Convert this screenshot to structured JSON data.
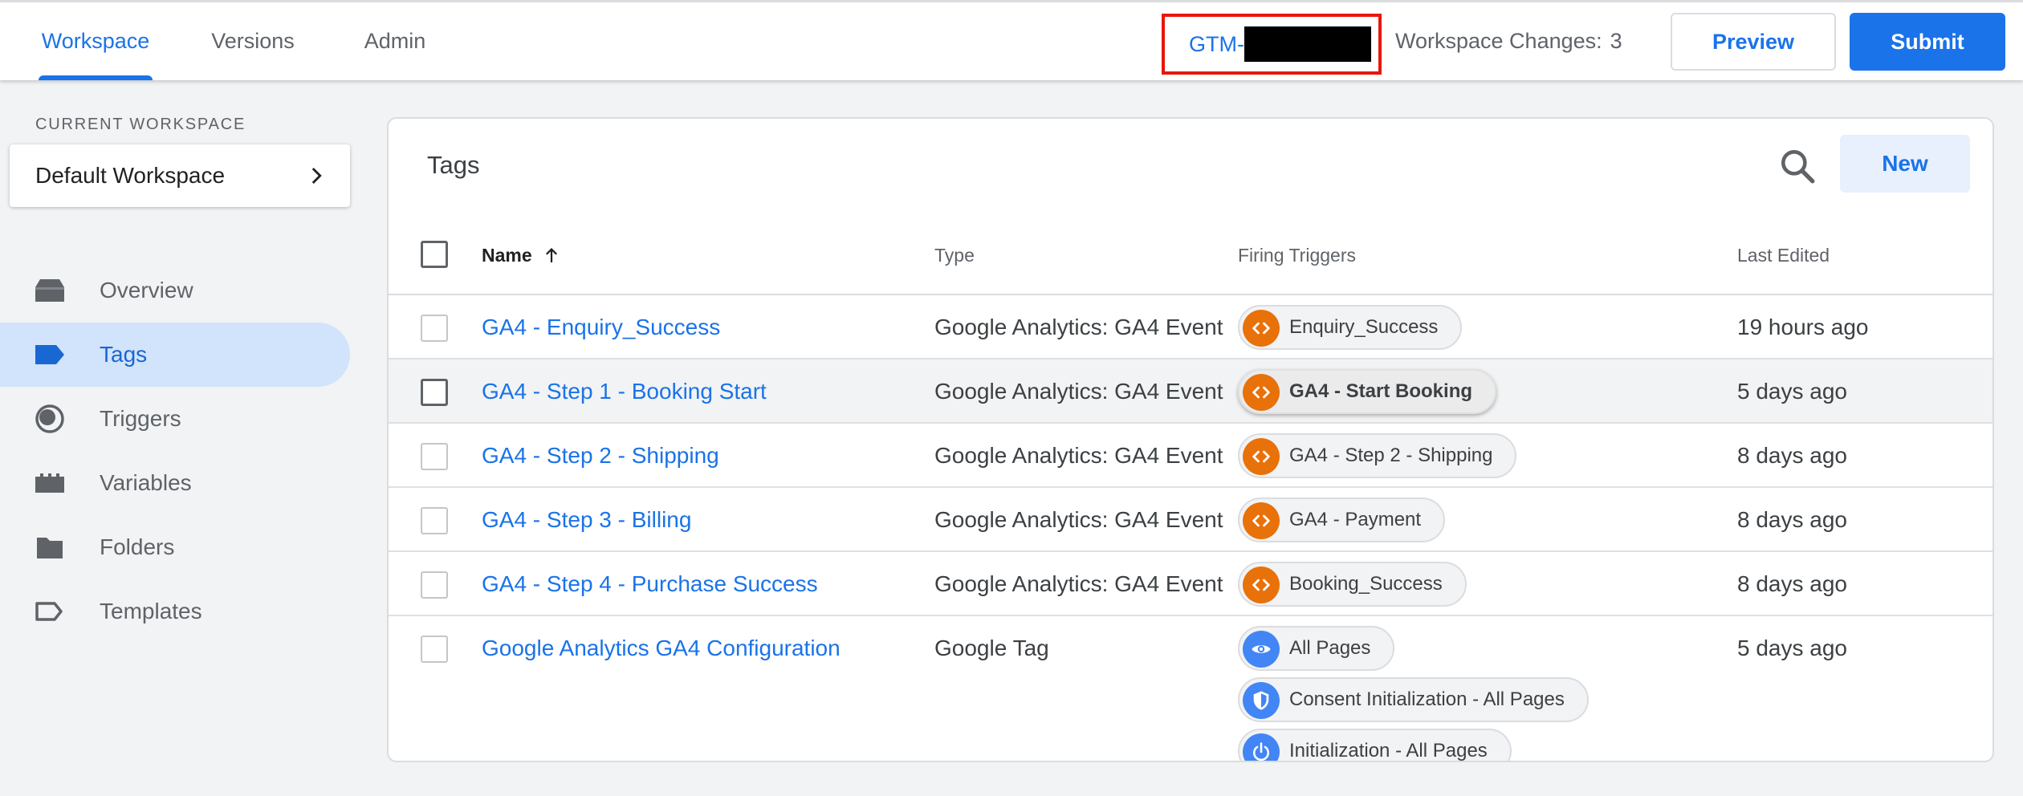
{
  "header": {
    "tabs": [
      {
        "label": "Workspace",
        "active": true
      },
      {
        "label": "Versions",
        "active": false
      },
      {
        "label": "Admin",
        "active": false
      }
    ],
    "container_id_prefix": "GTM-",
    "workspace_changes_label": "Workspace Changes:",
    "workspace_changes_count": "3",
    "preview_label": "Preview",
    "submit_label": "Submit"
  },
  "sidebar": {
    "current_workspace_label": "CURRENT WORKSPACE",
    "workspace_name": "Default Workspace",
    "items": [
      {
        "label": "Overview",
        "icon": "overview-icon"
      },
      {
        "label": "Tags",
        "icon": "tag-icon",
        "active": true
      },
      {
        "label": "Triggers",
        "icon": "trigger-icon"
      },
      {
        "label": "Variables",
        "icon": "variables-icon"
      },
      {
        "label": "Folders",
        "icon": "folder-icon"
      },
      {
        "label": "Templates",
        "icon": "template-icon"
      }
    ]
  },
  "tags_card": {
    "title": "Tags",
    "new_label": "New",
    "columns": {
      "name": "Name",
      "type": "Type",
      "firing_triggers": "Firing Triggers",
      "last_edited": "Last Edited"
    },
    "rows": [
      {
        "name": "GA4 - Enquiry_Success",
        "type": "Google Analytics: GA4 Event",
        "triggers": [
          {
            "label": "Enquiry_Success",
            "icon": "code-icon"
          }
        ],
        "last_edited": "19 hours ago"
      },
      {
        "name": "GA4 - Step 1 - Booking Start",
        "type": "Google Analytics: GA4 Event",
        "triggers": [
          {
            "label": "GA4 - Start Booking",
            "icon": "code-icon"
          }
        ],
        "last_edited": "5 days ago"
      },
      {
        "name": "GA4 - Step 2 - Shipping",
        "type": "Google Analytics: GA4 Event",
        "triggers": [
          {
            "label": "GA4 - Step 2 - Shipping",
            "icon": "code-icon"
          }
        ],
        "last_edited": "8 days ago"
      },
      {
        "name": "GA4 - Step 3 - Billing",
        "type": "Google Analytics: GA4 Event",
        "triggers": [
          {
            "label": "GA4 - Payment",
            "icon": "code-icon"
          }
        ],
        "last_edited": "8 days ago"
      },
      {
        "name": "GA4 - Step 4 - Purchase Success",
        "type": "Google Analytics: GA4 Event",
        "triggers": [
          {
            "label": "Booking_Success",
            "icon": "code-icon"
          }
        ],
        "last_edited": "8 days ago"
      },
      {
        "name": "Google Analytics GA4 Configuration",
        "type": "Google Tag",
        "triggers": [
          {
            "label": "All Pages",
            "icon": "eye-icon"
          },
          {
            "label": "Consent Initialization - All Pages",
            "icon": "shield-icon"
          },
          {
            "label": "Initialization - All Pages",
            "icon": "power-icon"
          }
        ],
        "last_edited": "5 days ago"
      }
    ]
  },
  "colors": {
    "accent": "#1a73e8",
    "trigger_orange": "#e8710a",
    "trigger_blue": "#4285f4",
    "highlight_box": "#e8160c"
  }
}
